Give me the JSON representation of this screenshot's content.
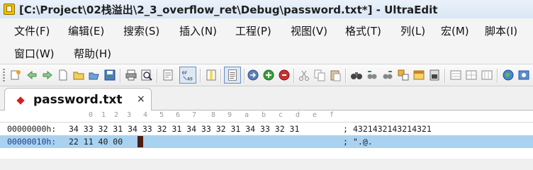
{
  "window": {
    "title": "[C:\\Project\\02栈溢出\\2_3_overflow_ret\\Debug\\password.txt*] - UltraEdit"
  },
  "menu": {
    "row1": [
      "文件(F)",
      "编辑(E)",
      "搜索(S)",
      "插入(N)",
      "工程(P)",
      "视图(V)",
      "格式(T)",
      "列(L)",
      "宏(M)",
      "脚本(I)"
    ],
    "row2": [
      "窗口(W)",
      "帮助(H)"
    ]
  },
  "toolbar": {
    "icons": [
      "new-file-icon",
      "back-arrow-icon",
      "forward-arrow-icon",
      "new-document-icon",
      "open-folder-icon",
      "open-file-icon",
      "save-icon",
      "print-icon",
      "print-preview-icon",
      "word-wrap-icon",
      "hex-mode-icon",
      "column-mode-icon",
      "list-lines-icon",
      "macro-record-icon",
      "macro-play-icon",
      "macro-stop-icon",
      "cut-icon",
      "copy-icon",
      "paste-icon",
      "find-icon",
      "find-prev-icon",
      "find-next-icon",
      "replace-icon",
      "toggle-bookmark-icon",
      "ftp-icon",
      "window-layout-1-icon",
      "window-layout-2-icon",
      "window-layout-3-icon",
      "web-browser-icon",
      "settings-icon"
    ]
  },
  "tab": {
    "label": "password.txt",
    "close": "×"
  },
  "hex": {
    "ruler": [
      "0",
      "1",
      "2",
      "3",
      "4",
      "5",
      "6",
      "7",
      "8",
      "9",
      "a",
      "b",
      "c",
      "d",
      "e",
      "f"
    ],
    "rows": [
      {
        "offset": "00000000h:",
        "bytes": "34 33 32 31 34 33 32 31 34 33 32 31 34 33 32 31",
        "sep": ";",
        "ascii": "4321432143214321"
      },
      {
        "offset": "00000010h:",
        "bytes": "22 11 40 00",
        "sep": ";",
        "ascii": "\".@."
      }
    ]
  }
}
